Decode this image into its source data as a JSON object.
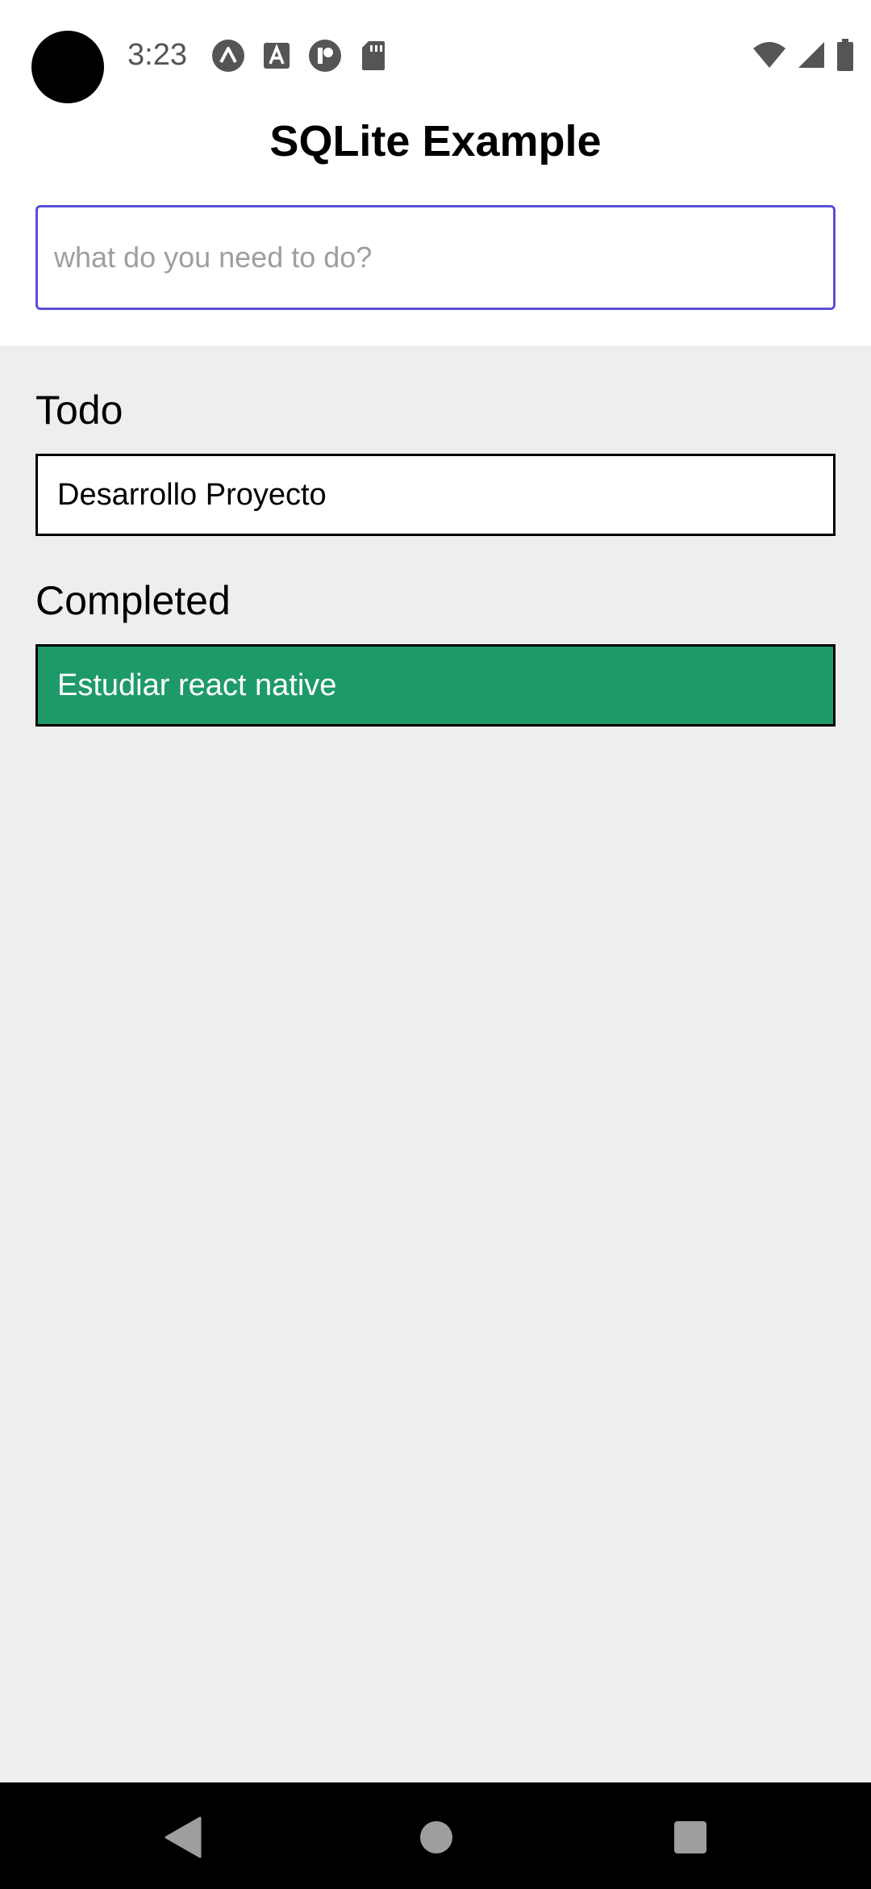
{
  "status_bar": {
    "time": "3:23",
    "notification_icons": [
      "expo-icon",
      "font-a-icon",
      "app-p-icon",
      "sd-card-icon"
    ],
    "system_icons": [
      "wifi-icon",
      "signal-icon",
      "battery-icon"
    ]
  },
  "header": {
    "title": "SQLite Example"
  },
  "input": {
    "placeholder": "what do you need to do?",
    "value": ""
  },
  "sections": {
    "todo": {
      "heading": "Todo",
      "items": [
        "Desarrollo Proyecto"
      ]
    },
    "completed": {
      "heading": "Completed",
      "items": [
        "Estudiar react native"
      ]
    }
  },
  "colors": {
    "input_border": "#5b4fd6",
    "completed_bg": "#1e9a68",
    "content_bg": "#eeeeee",
    "nav_bg": "#000000"
  }
}
